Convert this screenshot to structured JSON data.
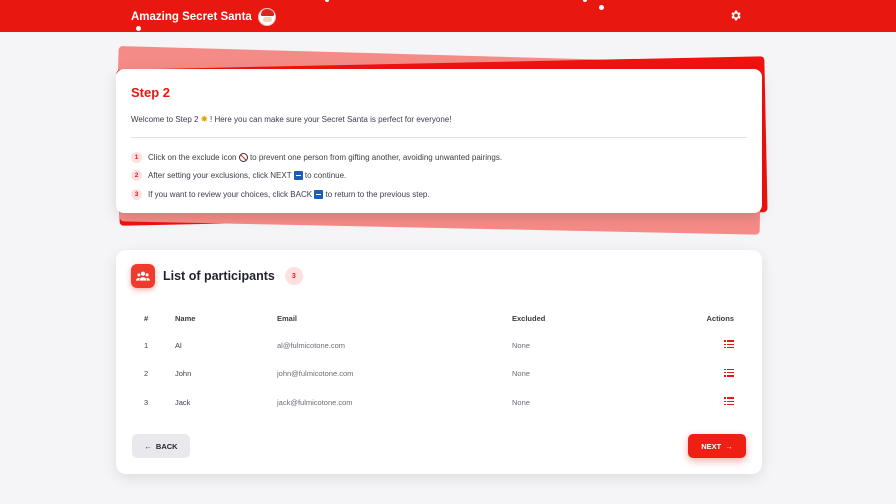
{
  "header": {
    "app_title": "Amazing Secret Santa",
    "logo_icon": "santa-icon",
    "settings_icon": "gear-icon",
    "background_color": "#e8170f"
  },
  "step": {
    "title": "Step 2",
    "welcome_prefix": "Welcome to Step 2 ",
    "welcome_suffix": "! Here you can make sure your Secret Santa is perfect for everyone!",
    "instructions": [
      {
        "num": "1",
        "before": "Click on the exclude icon ",
        "icon": "ban-icon",
        "after": " to prevent one person from gifting another, avoiding unwanted pairings."
      },
      {
        "num": "2",
        "before": "After setting your exclusions, click NEXT ",
        "icon": "next-key-icon",
        "after": " to continue."
      },
      {
        "num": "3",
        "before": "If you want to review your choices, click BACK ",
        "icon": "back-key-icon",
        "after": " to return to the previous step."
      }
    ]
  },
  "participants": {
    "title": "List of participants",
    "count": "3",
    "columns": {
      "num": "#",
      "name": "Name",
      "email": "Email",
      "excluded": "Excluded",
      "actions": "Actions"
    },
    "rows": [
      {
        "num": "1",
        "name": "Al",
        "email": "al@fulmicotone.com",
        "excluded": "None"
      },
      {
        "num": "2",
        "name": "John",
        "email": "john@fulmicotone.com",
        "excluded": "None"
      },
      {
        "num": "3",
        "name": "Jack",
        "email": "jack@fulmicotone.com",
        "excluded": "None"
      }
    ]
  },
  "buttons": {
    "back_label": "BACK",
    "next_label": "NEXT"
  },
  "colors": {
    "accent": "#e8170f",
    "accent_light": "#fde0df",
    "deco_pink": "#f58b86"
  }
}
